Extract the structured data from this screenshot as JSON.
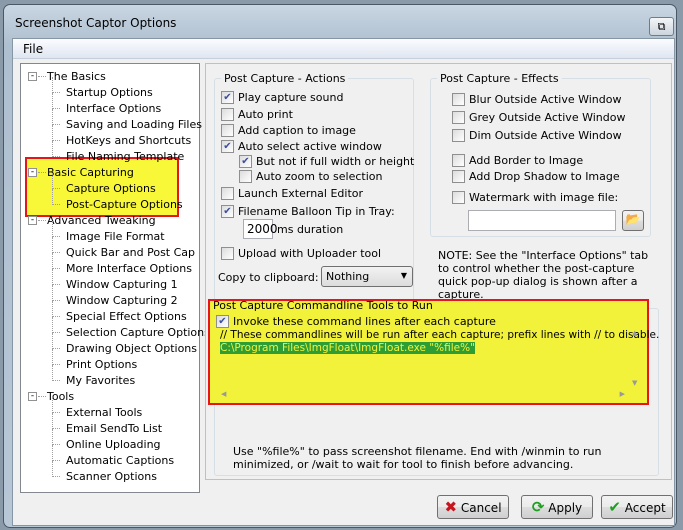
{
  "window": {
    "title": "Screenshot Captor Options"
  },
  "menu": {
    "file": "File"
  },
  "tree": [
    {
      "label": "The Basics",
      "level": 0,
      "expander": "-"
    },
    {
      "label": "Startup Options",
      "level": 1
    },
    {
      "label": "Interface Options",
      "level": 1
    },
    {
      "label": "Saving and Loading Files",
      "level": 1
    },
    {
      "label": "HotKeys and Shortcuts",
      "level": 1
    },
    {
      "label": "File Naming Template",
      "level": 1
    },
    {
      "label": "Basic Capturing",
      "level": 0,
      "expander": "-"
    },
    {
      "label": "Capture Options",
      "level": 1
    },
    {
      "label": "Post-Capture Options",
      "level": 1,
      "selected": true
    },
    {
      "label": "Advanced Tweaking",
      "level": 0,
      "expander": "-"
    },
    {
      "label": "Image File Format",
      "level": 1
    },
    {
      "label": "Quick Bar and Post Cap",
      "level": 1
    },
    {
      "label": "More Interface Options",
      "level": 1
    },
    {
      "label": "Window Capturing 1",
      "level": 1
    },
    {
      "label": "Window Capturing 2",
      "level": 1
    },
    {
      "label": "Special Effect Options",
      "level": 1
    },
    {
      "label": "Selection Capture Options",
      "level": 1
    },
    {
      "label": "Drawing Object Options",
      "level": 1
    },
    {
      "label": "Print Options",
      "level": 1
    },
    {
      "label": "My Favorites",
      "level": 1
    },
    {
      "label": "Tools",
      "level": 0,
      "expander": "-"
    },
    {
      "label": "External Tools",
      "level": 1
    },
    {
      "label": "Email SendTo List",
      "level": 1
    },
    {
      "label": "Online Uploading",
      "level": 1
    },
    {
      "label": "Automatic Captions",
      "level": 1
    },
    {
      "label": "Scanner Options",
      "level": 1
    }
  ],
  "actions": {
    "title": "Post Capture - Actions",
    "play_sound": {
      "label": "Play capture sound",
      "checked": true
    },
    "auto_print": {
      "label": "Auto print",
      "checked": false
    },
    "add_caption": {
      "label": "Add caption to image",
      "checked": false
    },
    "auto_select": {
      "label": "Auto select active window",
      "checked": true
    },
    "not_full": {
      "label": "But not if full width or height",
      "checked": true
    },
    "auto_zoom": {
      "label": "Auto zoom to selection",
      "checked": false
    },
    "launch_editor": {
      "label": "Launch External Editor",
      "checked": false
    },
    "balloon": {
      "label": "Filename Balloon Tip in Tray:",
      "checked": true
    },
    "duration_value": "2000",
    "duration_unit": "ms duration",
    "upload": {
      "label": "Upload with Uploader tool",
      "checked": false
    },
    "clipboard_label": "Copy to clipboard:",
    "clipboard_value": "Nothing"
  },
  "effects": {
    "title": "Post Capture - Effects",
    "blur": {
      "label": "Blur Outside Active Window",
      "checked": false
    },
    "grey": {
      "label": "Grey Outside Active Window",
      "checked": false
    },
    "dim": {
      "label": "Dim Outside Active Window",
      "checked": false
    },
    "border": {
      "label": "Add Border to Image",
      "checked": false
    },
    "shadow": {
      "label": "Add Drop Shadow to Image",
      "checked": false
    },
    "watermark": {
      "label": "Watermark with image file:",
      "checked": false
    },
    "watermark_file": ""
  },
  "note": "NOTE: See the \"Interface Options\" tab to control whether the post-capture quick pop-up dialog is shown after a capture.",
  "commandline": {
    "title": "Post Capture Commandline Tools to Run",
    "invoke": {
      "label": "Invoke these command lines after each capture",
      "checked": true
    },
    "line1": "// These commandlines will be run after each capture; prefix lines with // to disable.",
    "line2": "C:\\Program Files\\ImgFloat\\ImgFloat.exe \"%file%\"",
    "help": "Use \"%file%\" to pass screenshot filename. End with /winmin to run minimized, or /wait to wait for tool to finish before advancing."
  },
  "buttons": {
    "cancel": "Cancel",
    "apply": "Apply",
    "accept": "Accept"
  }
}
